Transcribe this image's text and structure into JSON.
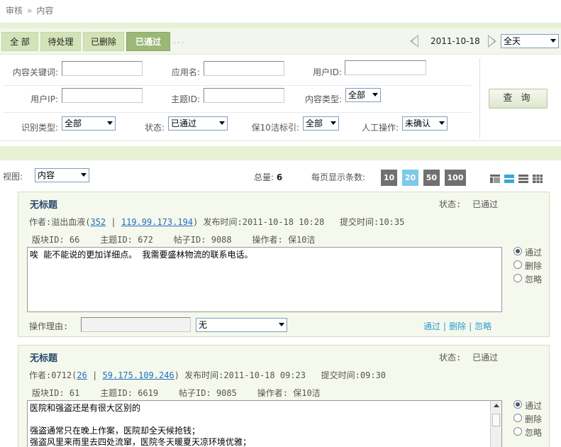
{
  "breadcrumb": {
    "part1": "审核",
    "sep": "»",
    "part2": "内容"
  },
  "tabs": [
    {
      "label": "全 部"
    },
    {
      "label": "待处理"
    },
    {
      "label": "已删除"
    },
    {
      "label": "已通过"
    }
  ],
  "more": "...",
  "date": "2011-10-18",
  "period": "全天",
  "filters": {
    "keyword_label": "内容关键词:",
    "app_label": "应用名:",
    "userid_label": "用户ID:",
    "userip_label": "用户IP:",
    "topicid_label": "主题ID:",
    "contenttype_label": "内容类型:",
    "contenttype_value": "全部",
    "recog_label": "识别类型:",
    "recog_value": "全部",
    "status_label": "状态:",
    "status_value": "已通过",
    "bao10_label": "保10洁标引:",
    "bao10_value": "全部",
    "manual_label": "人工操作:",
    "manual_value": "未确认",
    "query_label": "查 询"
  },
  "view": {
    "label": "视图:",
    "value": "内容"
  },
  "total": {
    "label": "总量:",
    "value": "6"
  },
  "perpage": {
    "label": "每页显示条数:",
    "options": [
      "10",
      "20",
      "50",
      "100"
    ],
    "selected": "20"
  },
  "cards": [
    {
      "title": "无标题",
      "status_label": "状态:",
      "status_value": "已通过",
      "author_label": "作者:",
      "author": "溢出血液",
      "uid": "352",
      "sep": "|",
      "ip": "119.99.173.194",
      "pub_label": "发布时间:",
      "pub_time": "2011-10-18 10:28",
      "sub_label": "提交时间:",
      "sub_time": "10:35",
      "board_label": "版块ID:",
      "board": "66",
      "topic_label": "主题ID:",
      "topic": "672",
      "post_label": "帖子ID:",
      "post": "9088",
      "op_label": "操作者:",
      "op": "保10洁",
      "content": "唉 能不能说的更加详细点。 我需要盛林物流的联系电话。",
      "radio1": "通过",
      "radio2": "删除",
      "radio3": "忽略",
      "reason_label": "操作理由:",
      "reason_value": "无",
      "act1": "通过",
      "act2": "删除",
      "act3": "忽略",
      "actsep": "|"
    },
    {
      "title": "无标题",
      "status_label": "状态:",
      "status_value": "已通过",
      "author_label": "作者:",
      "author": "0712",
      "uid": "26",
      "sep": "|",
      "ip": "59.175.109.246",
      "pub_label": "发布时间:",
      "pub_time": "2011-10-18 09:23",
      "sub_label": "提交时间:",
      "sub_time": "09:30",
      "board_label": "版块ID:",
      "board": "61",
      "topic_label": "主题ID:",
      "topic": "6619",
      "post_label": "帖子ID:",
      "post": "9085",
      "op_label": "操作者:",
      "op": "保10洁",
      "content": "医院和强盗还是有很大区别的\n\n强盗通常只在晚上作案，医院却全天候抢钱；\n强盗风里来雨里去四处流窜，医院冬天暖夏天凉环境优雅；\n你把钱交给强盗是为了活命，你为了活命而把钱交给医院；",
      "radio1": "通过",
      "radio2": "删除",
      "radio3": "忽略"
    }
  ]
}
